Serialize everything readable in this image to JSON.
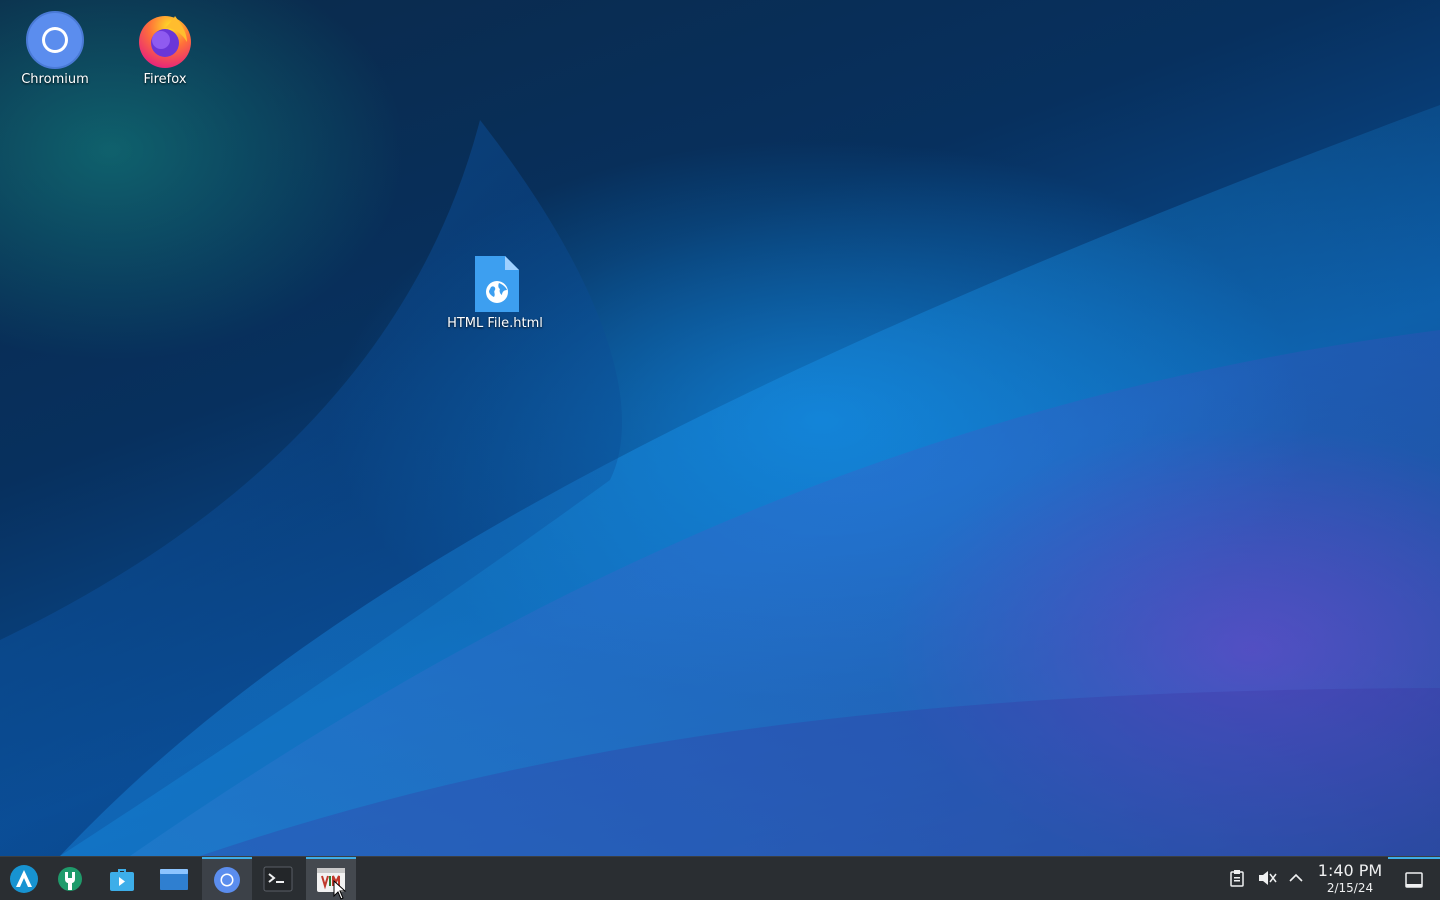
{
  "desktop": {
    "icons": [
      {
        "label": "Chromium",
        "icon": "chromium-icon"
      },
      {
        "label": "Firefox",
        "icon": "firefox-icon"
      },
      {
        "label": "HTML File.html",
        "icon": "html-file-icon"
      }
    ]
  },
  "taskbar": {
    "launchers": [
      {
        "icon": "application-launcher-icon"
      },
      {
        "icon": "system-settings-icon"
      },
      {
        "icon": "discover-store-icon"
      },
      {
        "icon": "file-manager-icon"
      },
      {
        "icon": "chromium-icon",
        "state": "active"
      },
      {
        "icon": "terminal-icon"
      },
      {
        "icon": "vim-icon",
        "state": "hover"
      }
    ],
    "tray": [
      {
        "icon": "clipboard-icon"
      },
      {
        "icon": "volume-muted-icon"
      },
      {
        "icon": "chevron-up-icon"
      }
    ],
    "clock": {
      "time": "1:40 PM",
      "date": "2/15/24"
    },
    "show_desktop_icon": "show-desktop-icon"
  },
  "colors": {
    "accent": "#3daee9",
    "taskbar_bg": "#2a2e32",
    "text": "#eff0f1"
  }
}
